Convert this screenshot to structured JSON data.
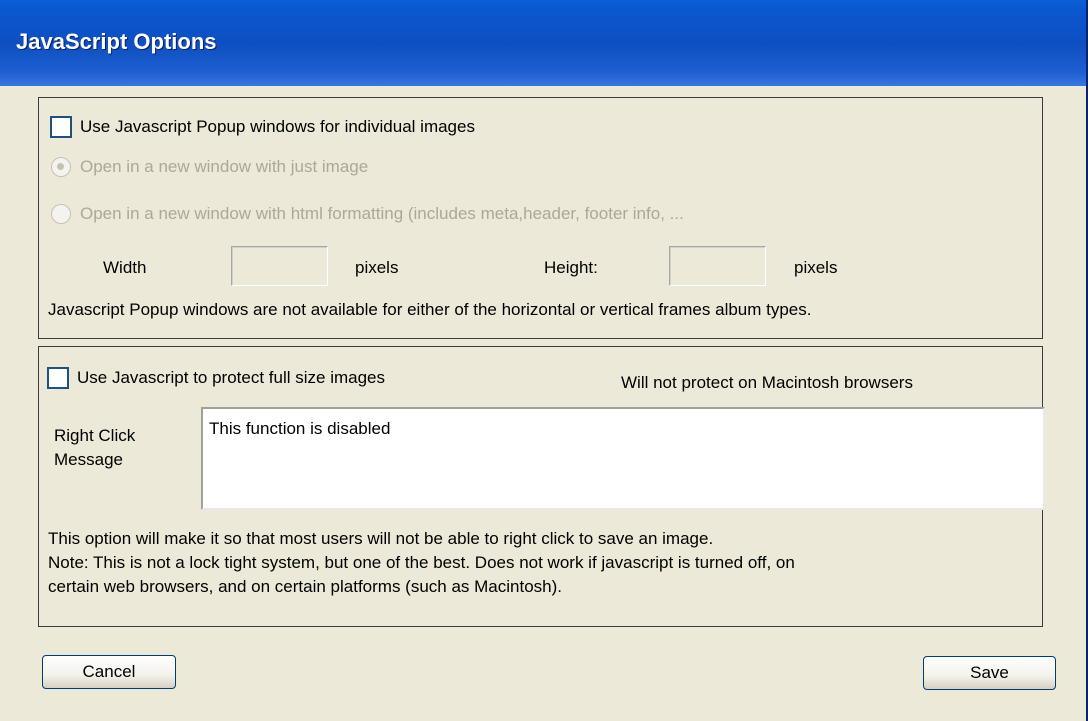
{
  "window": {
    "title": "JavaScript Options"
  },
  "popup_group": {
    "checkbox_label": "Use Javascript Popup windows for individual images",
    "checked": false,
    "radio_image_only": "Open in a new window with just image",
    "radio_html": "Open in a new window with html formatting (includes meta,header, footer info, ...",
    "width_label": "Width",
    "width_value": "",
    "width_unit": "pixels",
    "height_label": "Height:",
    "height_value": "",
    "height_unit": "pixels",
    "note": "Javascript Popup windows are not available for either of the horizontal or vertical frames album types."
  },
  "protect_group": {
    "checkbox_label": "Use Javascript to protect full size images",
    "checked": false,
    "mac_warning": "Will not protect on Macintosh browsers",
    "message_label_line1": "Right Click",
    "message_label_line2": "Message",
    "message_value": "This function is disabled",
    "desc_line1": "This option will make it so that most users will not be able to right click to save an image.",
    "desc_line2": "Note:   This is not a lock tight system, but one of the best. Does not work if javascript is turned off, on",
    "desc_line3": "certain web browsers, and on certain platforms (such as Macintosh)."
  },
  "buttons": {
    "cancel": "Cancel",
    "save": "Save"
  }
}
